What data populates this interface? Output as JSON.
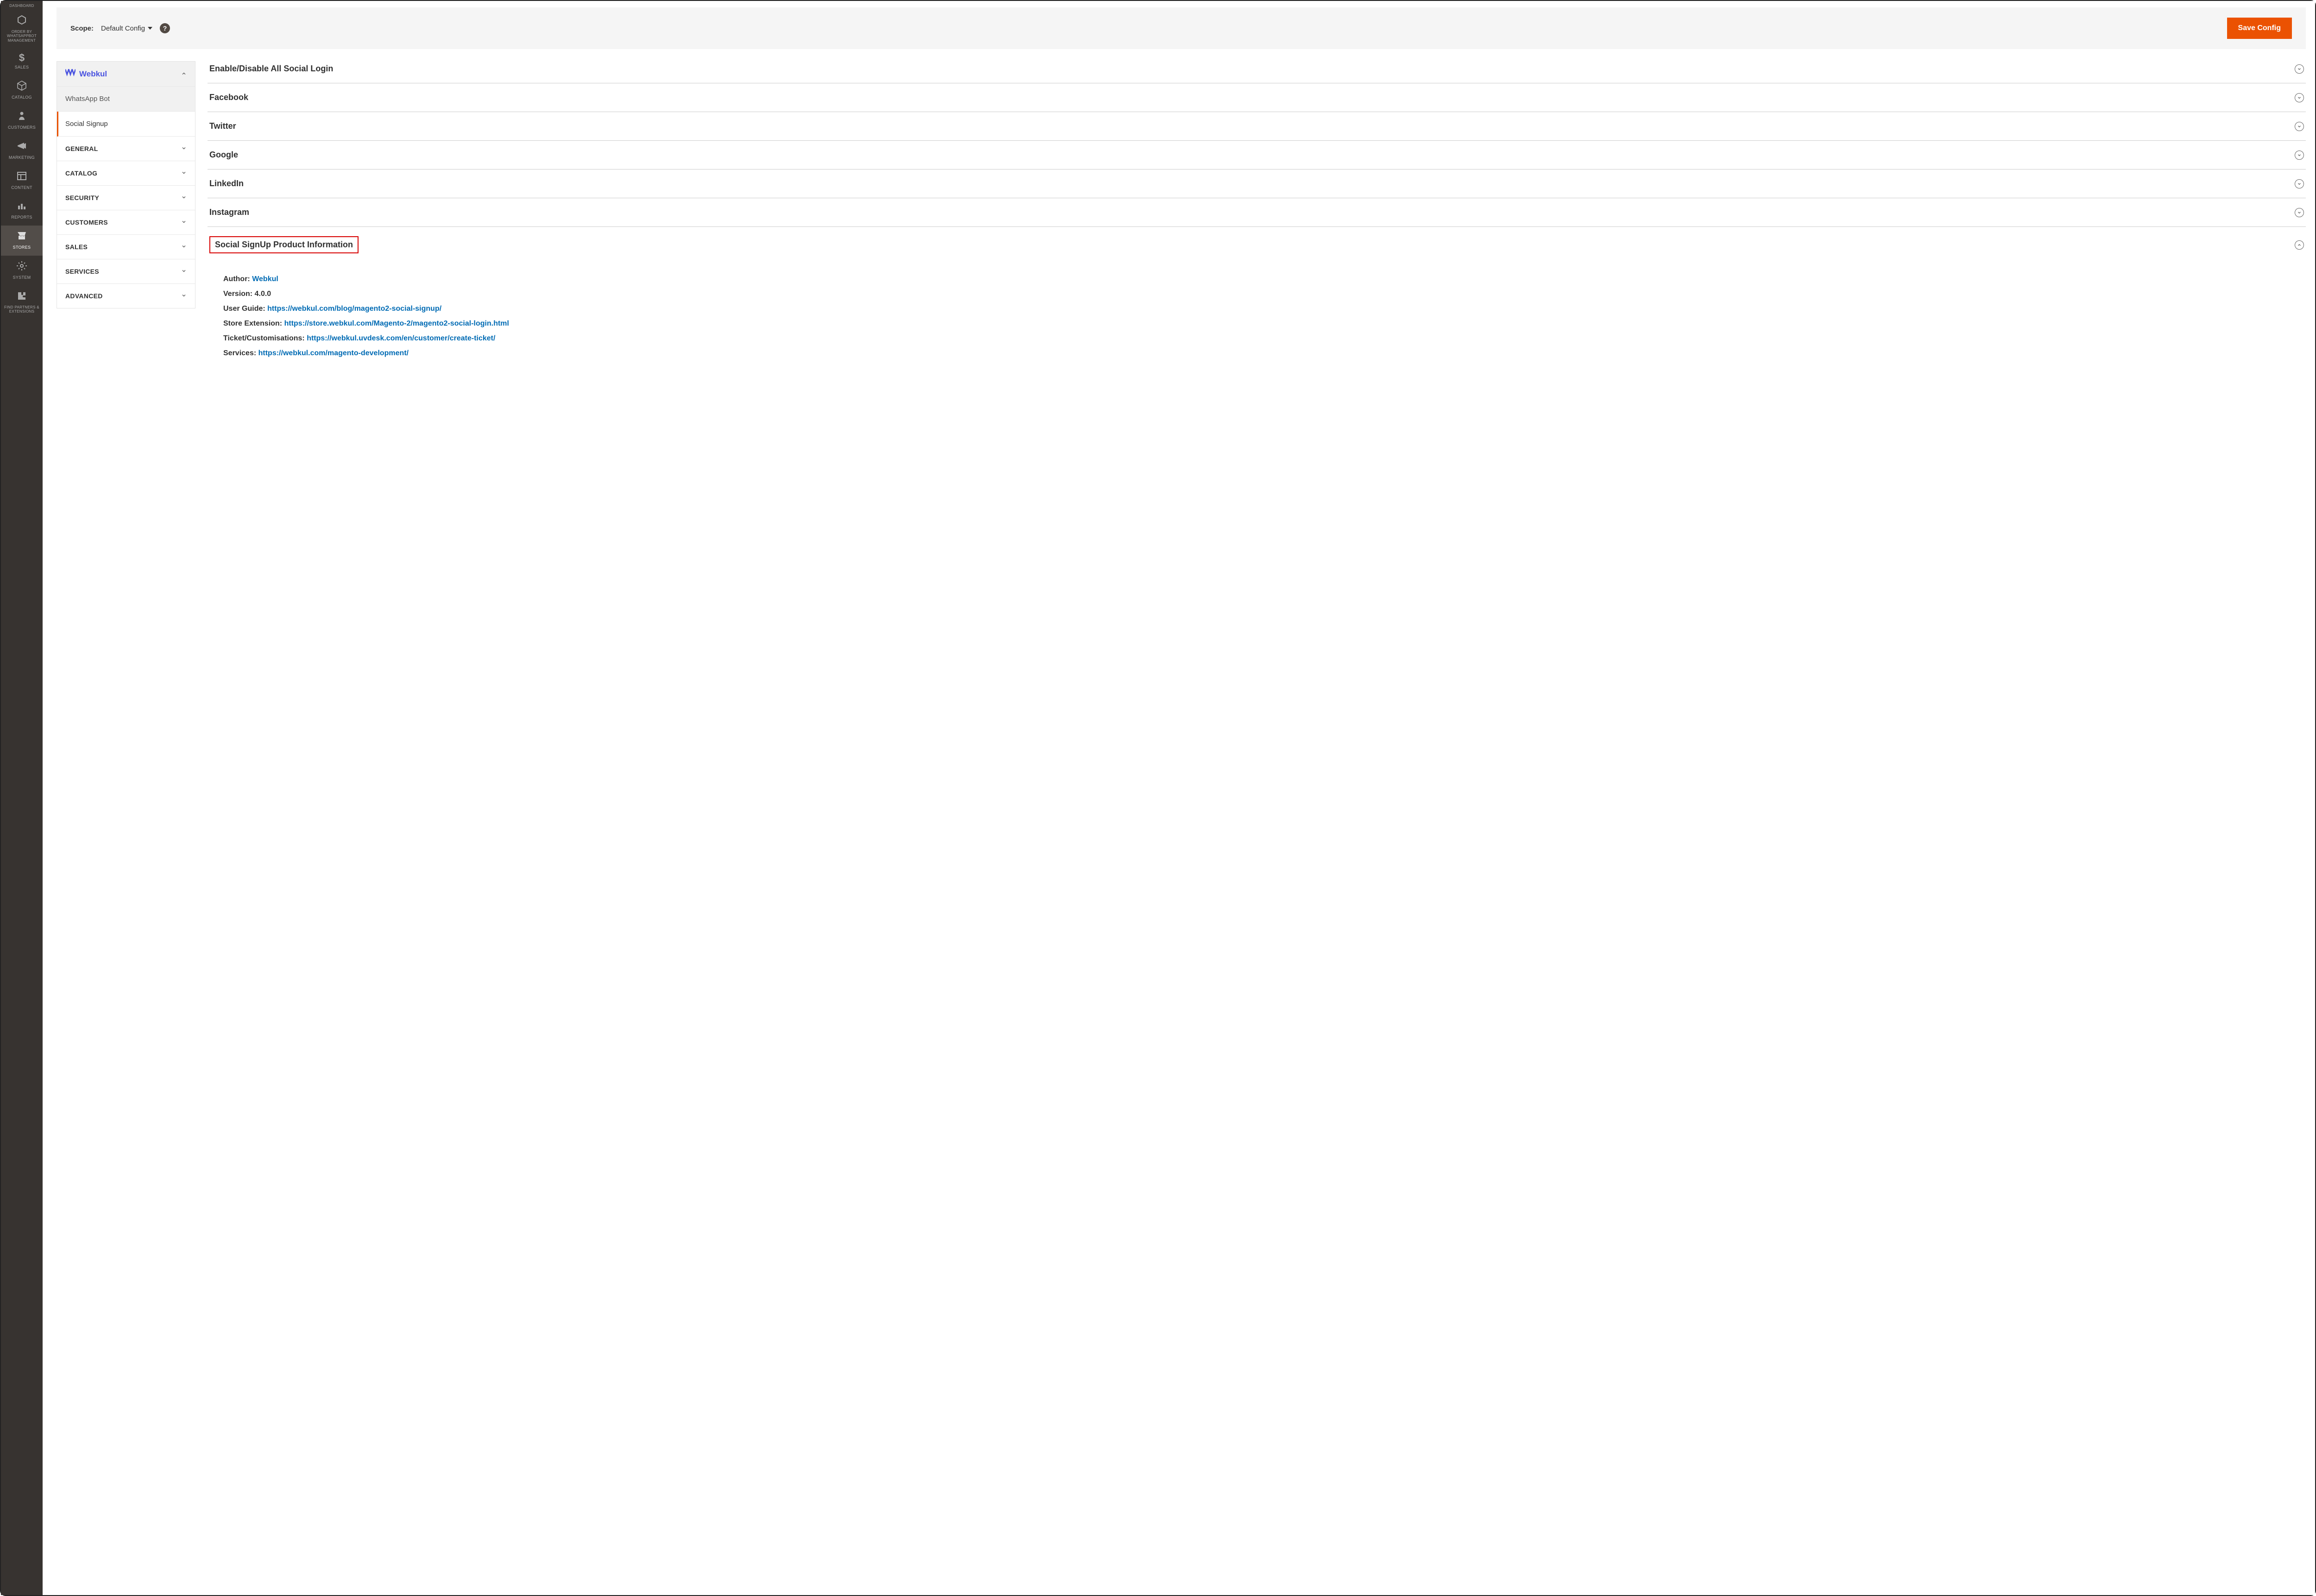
{
  "sidebar": {
    "items": [
      {
        "label": "DASHBOARD"
      },
      {
        "label": "ORDER BY WHATSAPPBOT MANAGEMENT"
      },
      {
        "label": "SALES"
      },
      {
        "label": "CATALOG"
      },
      {
        "label": "CUSTOMERS"
      },
      {
        "label": "MARKETING"
      },
      {
        "label": "CONTENT"
      },
      {
        "label": "REPORTS"
      },
      {
        "label": "STORES"
      },
      {
        "label": "SYSTEM"
      },
      {
        "label": "FIND PARTNERS & EXTENSIONS"
      }
    ]
  },
  "scopebar": {
    "scope_label": "Scope:",
    "scope_value": "Default Config",
    "save_label": "Save Config"
  },
  "config_tabs": {
    "webkul_label": "Webkul",
    "sub": [
      {
        "label": "WhatsApp Bot"
      },
      {
        "label": "Social Signup"
      }
    ],
    "groups": [
      {
        "label": "GENERAL"
      },
      {
        "label": "CATALOG"
      },
      {
        "label": "SECURITY"
      },
      {
        "label": "CUSTOMERS"
      },
      {
        "label": "SALES"
      },
      {
        "label": "SERVICES"
      },
      {
        "label": "ADVANCED"
      }
    ]
  },
  "sections": [
    {
      "title": "Enable/Disable All Social Login",
      "expanded": false
    },
    {
      "title": "Facebook",
      "expanded": false
    },
    {
      "title": "Twitter",
      "expanded": false
    },
    {
      "title": "Google",
      "expanded": false
    },
    {
      "title": "LinkedIn",
      "expanded": false
    },
    {
      "title": "Instagram",
      "expanded": false
    },
    {
      "title": "Social SignUp Product Information",
      "expanded": true,
      "highlight": true
    }
  ],
  "product_info": {
    "author_label": "Author:",
    "author_link": "Webkul",
    "version_label": "Version:",
    "version_value": "4.0.0",
    "userguide_label": "User Guide:",
    "userguide_link": "https://webkul.com/blog/magento2-social-signup/",
    "store_label": "Store Extension:",
    "store_link": "https://store.webkul.com/Magento-2/magento2-social-login.html",
    "ticket_label": "Ticket/Customisations:",
    "ticket_link": "https://webkul.uvdesk.com/en/customer/create-ticket/",
    "services_label": "Services:",
    "services_link": "https://webkul.com/magento-development/"
  }
}
